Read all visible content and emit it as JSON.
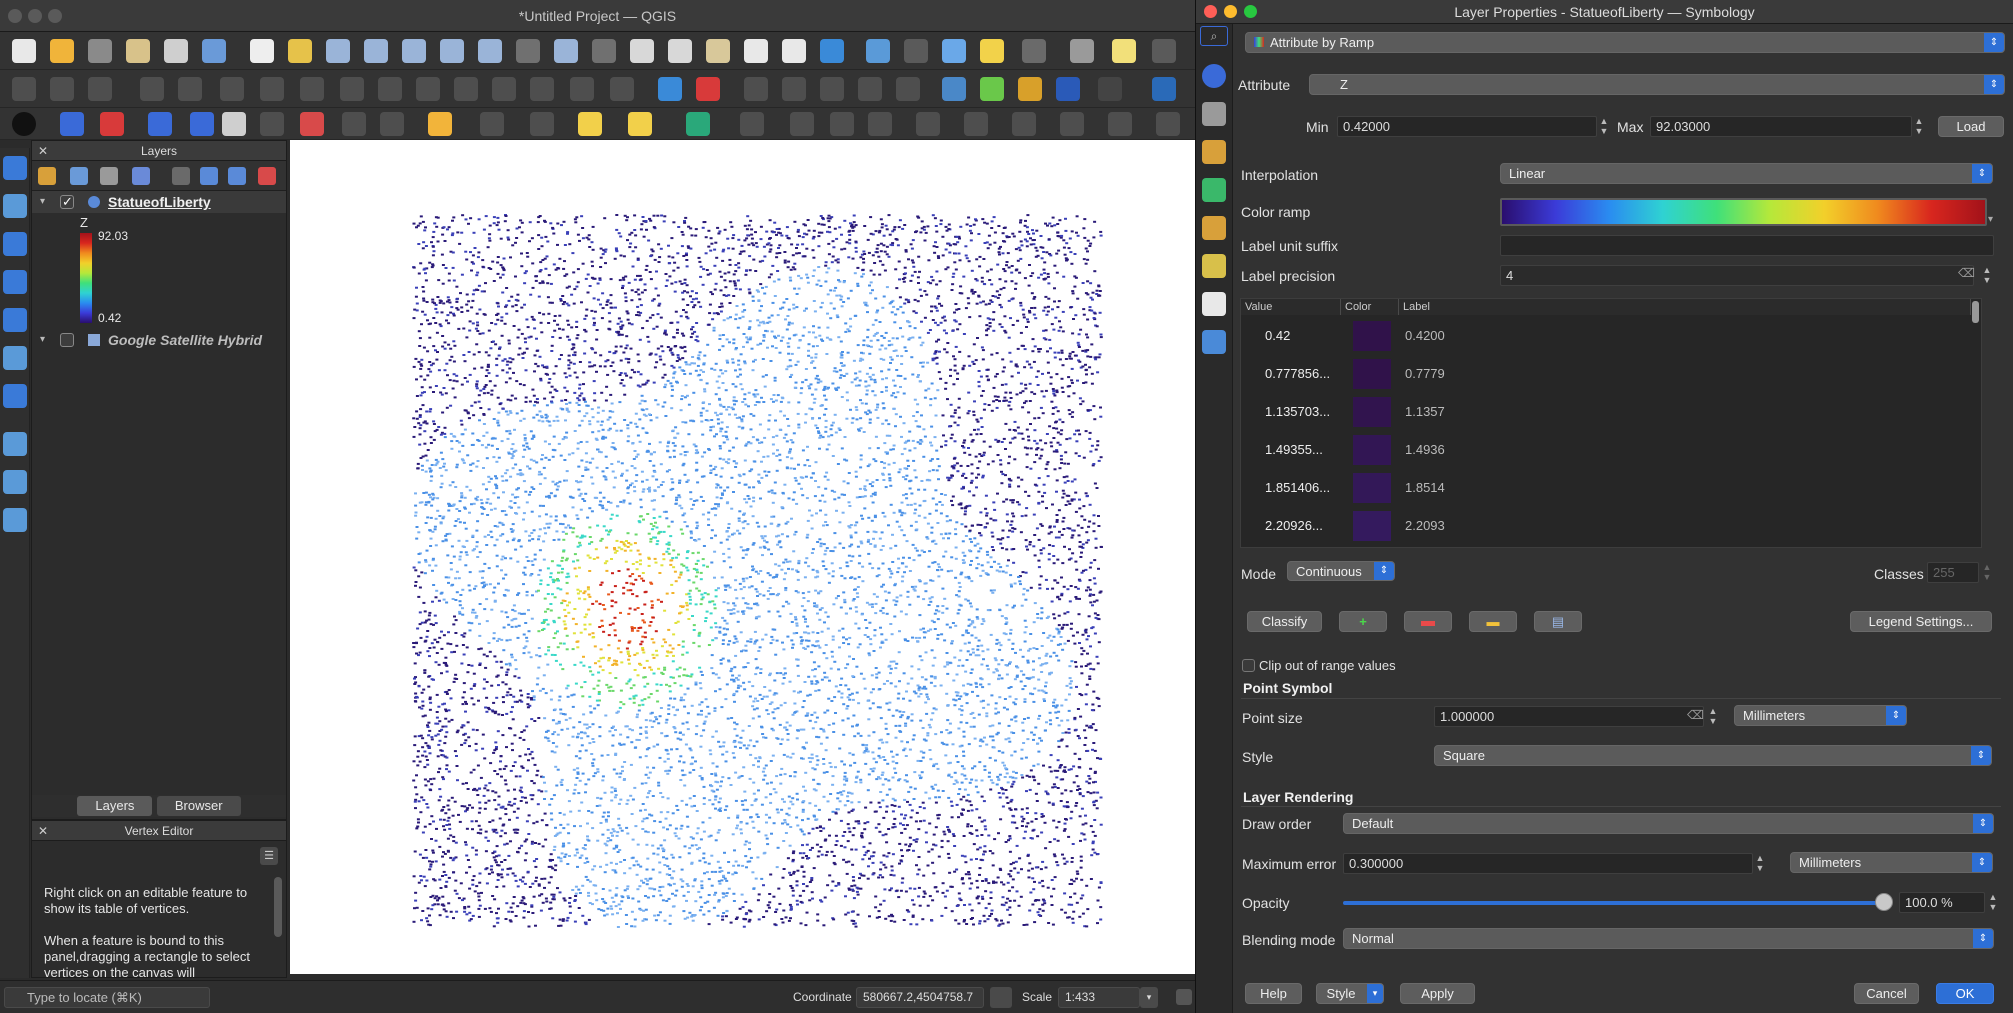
{
  "app": {
    "window_title": "*Untitled Project — QGIS"
  },
  "layers_panel": {
    "title": "Layers",
    "tabs": [
      "Layers",
      "Browser"
    ],
    "layers": [
      {
        "name": "StatueofLiberty",
        "checked": true,
        "legend_field": "Z",
        "legend_max": "92.03",
        "legend_min": "0.42"
      },
      {
        "name": "Google Satellite Hybrid",
        "checked": false
      }
    ]
  },
  "vertex_editor": {
    "title": "Vertex Editor",
    "text": "Right click on an editable feature to show its table of vertices.\n\nWhen a feature is bound to this panel,dragging a rectangle to select vertices on the canvas will"
  },
  "status_bar": {
    "locate_placeholder": "Type to locate (⌘K)",
    "coordinate_label": "Coordinate",
    "coordinate_value": "580667.2,4504758.7",
    "scale_label": "Scale",
    "scale_value": "1:433"
  },
  "dialog": {
    "title": "Layer Properties - StatueofLiberty — Symbology",
    "renderer": "Attribute by Ramp",
    "attribute_label": "Attribute",
    "attribute_value": "Z",
    "min_label": "Min",
    "min_value": "0.42000",
    "max_label": "Max",
    "max_value": "92.03000",
    "load_button": "Load",
    "interpolation_label": "Interpolation",
    "interpolation_value": "Linear",
    "color_ramp_label": "Color ramp",
    "label_unit_suffix_label": "Label unit suffix",
    "label_unit_suffix_value": "",
    "label_precision_label": "Label precision",
    "label_precision_value": "4",
    "table": {
      "headers": [
        "Value",
        "Color",
        "Label"
      ],
      "rows": [
        {
          "value": "0.42",
          "label": "0.4200"
        },
        {
          "value": "0.777856...",
          "label": "0.7779"
        },
        {
          "value": "1.135703...",
          "label": "1.1357"
        },
        {
          "value": "1.49355...",
          "label": "1.4936"
        },
        {
          "value": "1.851406...",
          "label": "1.8514"
        },
        {
          "value": "2.20926...",
          "label": "2.2093"
        }
      ]
    },
    "mode_label": "Mode",
    "mode_value": "Continuous",
    "classes_label": "Classes",
    "classes_value": "255",
    "classify_button": "Classify",
    "legend_settings_button": "Legend Settings...",
    "clip_label": "Clip out of range values",
    "point_symbol_section": "Point Symbol",
    "point_size_label": "Point size",
    "point_size_value": "1.000000",
    "point_size_unit": "Millimeters",
    "style_label": "Style",
    "style_value": "Square",
    "layer_rendering_section": "Layer Rendering",
    "draw_order_label": "Draw order",
    "draw_order_value": "Default",
    "max_error_label": "Maximum error",
    "max_error_value": "0.300000",
    "max_error_unit": "Millimeters",
    "opacity_label": "Opacity",
    "opacity_value": "100.0 %",
    "blending_label": "Blending mode",
    "blending_value": "Normal",
    "help_button": "Help",
    "style_button": "Style",
    "apply_button": "Apply",
    "cancel_button": "Cancel",
    "ok_button": "OK"
  },
  "colors": {
    "accent": "#2d6fd6",
    "ramp": [
      "#2a0e6e",
      "#3b3bd8",
      "#2a8cf0",
      "#2fd2d2",
      "#3fe07a",
      "#b6e83a",
      "#f2d02a",
      "#f08a1e",
      "#d8261e",
      "#a2121a"
    ]
  }
}
